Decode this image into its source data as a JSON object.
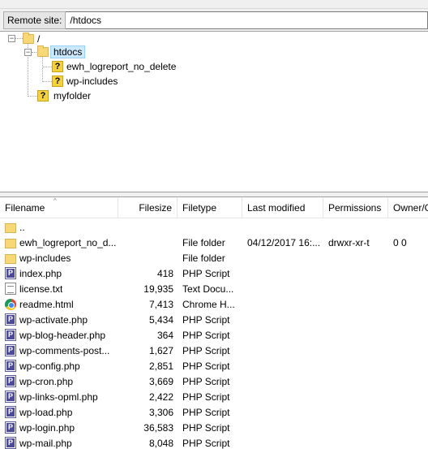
{
  "remote_site": {
    "label": "Remote site:",
    "path": "/htdocs"
  },
  "tree": {
    "root": "/",
    "htdocs": "htdocs",
    "ewh": "ewh_logreport_no_delete",
    "wp_includes": "wp-includes",
    "myfolder": "myfolder"
  },
  "columns": {
    "filename": "Filename",
    "filesize": "Filesize",
    "filetype": "Filetype",
    "last_modified": "Last modified",
    "permissions": "Permissions",
    "owner": "Owner/G"
  },
  "files": [
    {
      "icon": "folder-icon",
      "name": "..",
      "size": "",
      "type": "",
      "modified": "",
      "perms": "",
      "owner": ""
    },
    {
      "icon": "folder-icon",
      "name": "ewh_logreport_no_d...",
      "size": "",
      "type": "File folder",
      "modified": "04/12/2017 16:...",
      "perms": "drwxr-xr-t",
      "owner": "0 0"
    },
    {
      "icon": "folder-icon",
      "name": "wp-includes",
      "size": "",
      "type": "File folder",
      "modified": "",
      "perms": "",
      "owner": ""
    },
    {
      "icon": "php-file-icon",
      "name": "index.php",
      "size": "418",
      "type": "PHP Script",
      "modified": "",
      "perms": "",
      "owner": ""
    },
    {
      "icon": "text-file-icon",
      "name": "license.txt",
      "size": "19,935",
      "type": "Text Docu...",
      "modified": "",
      "perms": "",
      "owner": ""
    },
    {
      "icon": "chrome-html-icon",
      "name": "readme.html",
      "size": "7,413",
      "type": "Chrome H...",
      "modified": "",
      "perms": "",
      "owner": ""
    },
    {
      "icon": "php-file-icon",
      "name": "wp-activate.php",
      "size": "5,434",
      "type": "PHP Script",
      "modified": "",
      "perms": "",
      "owner": ""
    },
    {
      "icon": "php-file-icon",
      "name": "wp-blog-header.php",
      "size": "364",
      "type": "PHP Script",
      "modified": "",
      "perms": "",
      "owner": ""
    },
    {
      "icon": "php-file-icon",
      "name": "wp-comments-post...",
      "size": "1,627",
      "type": "PHP Script",
      "modified": "",
      "perms": "",
      "owner": ""
    },
    {
      "icon": "php-file-icon",
      "name": "wp-config.php",
      "size": "2,851",
      "type": "PHP Script",
      "modified": "",
      "perms": "",
      "owner": ""
    },
    {
      "icon": "php-file-icon",
      "name": "wp-cron.php",
      "size": "3,669",
      "type": "PHP Script",
      "modified": "",
      "perms": "",
      "owner": ""
    },
    {
      "icon": "php-file-icon",
      "name": "wp-links-opml.php",
      "size": "2,422",
      "type": "PHP Script",
      "modified": "",
      "perms": "",
      "owner": ""
    },
    {
      "icon": "php-file-icon",
      "name": "wp-load.php",
      "size": "3,306",
      "type": "PHP Script",
      "modified": "",
      "perms": "",
      "owner": ""
    },
    {
      "icon": "php-file-icon",
      "name": "wp-login.php",
      "size": "36,583",
      "type": "PHP Script",
      "modified": "",
      "perms": "",
      "owner": ""
    },
    {
      "icon": "php-file-icon",
      "name": "wp-mail.php",
      "size": "8,048",
      "type": "PHP Script",
      "modified": "",
      "perms": "",
      "owner": ""
    }
  ]
}
